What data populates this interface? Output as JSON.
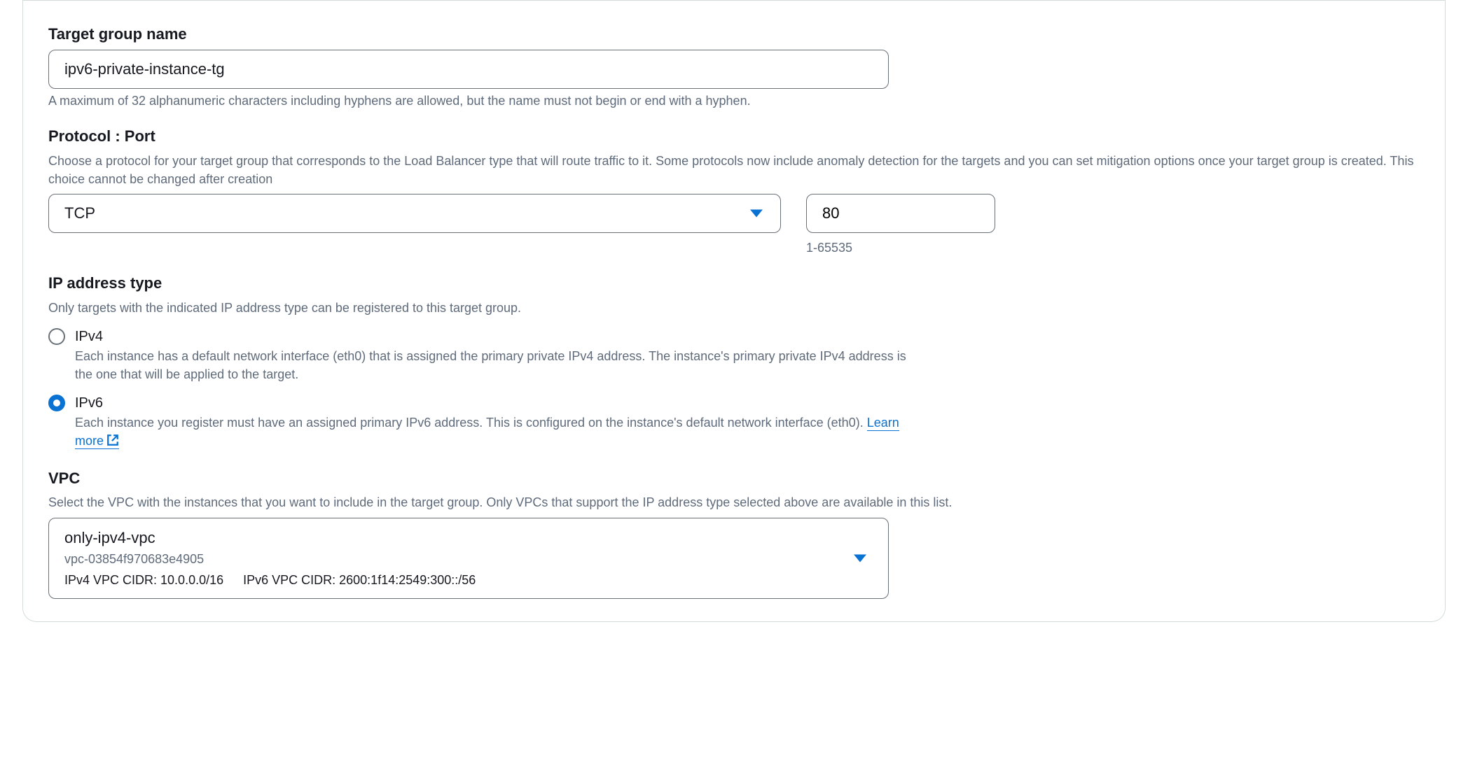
{
  "targetGroupName": {
    "label": "Target group name",
    "value": "ipv6-private-instance-tg",
    "hint": "A maximum of 32 alphanumeric characters including hyphens are allowed, but the name must not begin or end with a hyphen."
  },
  "protocolPort": {
    "label": "Protocol : Port",
    "hint": "Choose a protocol for your target group that corresponds to the Load Balancer type that will route traffic to it. Some protocols now include anomaly detection for the targets and you can set mitigation options once your target group is created. This choice cannot be changed after creation",
    "protocol": "TCP",
    "port": "80",
    "portRange": "1-65535"
  },
  "ipAddressType": {
    "label": "IP address type",
    "hint": "Only targets with the indicated IP address type can be registered to this target group.",
    "options": {
      "ipv4": {
        "label": "IPv4",
        "desc": "Each instance has a default network interface (eth0) that is assigned the primary private IPv4 address. The instance's primary private IPv4 address is the one that will be applied to the target."
      },
      "ipv6": {
        "label": "IPv6",
        "desc": "Each instance you register must have an assigned primary IPv6 address. This is configured on the instance's default network interface (eth0). ",
        "learnMore": "Learn more"
      }
    },
    "selected": "ipv6"
  },
  "vpc": {
    "label": "VPC",
    "hint": "Select the VPC with the instances that you want to include in the target group. Only VPCs that support the IP address type selected above are available in this list.",
    "selected": {
      "name": "only-ipv4-vpc",
      "id": "vpc-03854f970683e4905",
      "ipv4cidr": "IPv4 VPC CIDR: 10.0.0.0/16",
      "ipv6cidr": "IPv6 VPC CIDR: 2600:1f14:2549:300::/56"
    }
  }
}
